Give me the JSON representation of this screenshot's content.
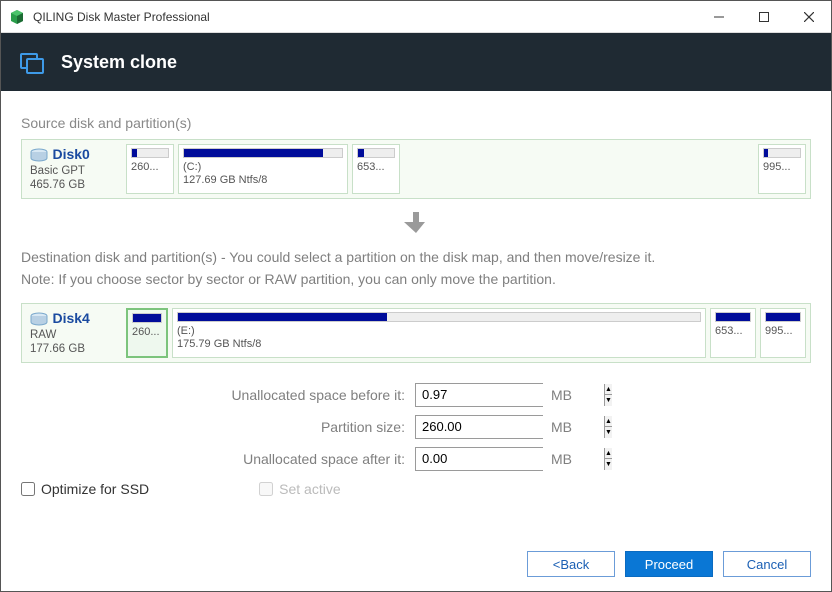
{
  "titlebar": {
    "title": "QILING Disk Master Professional"
  },
  "header": {
    "title": "System clone"
  },
  "source": {
    "label": "Source disk and partition(s)",
    "disk": {
      "name": "Disk0",
      "type": "Basic GPT",
      "size": "465.76 GB"
    },
    "parts": [
      {
        "label1": "",
        "label2": "260...",
        "fillPct": 14,
        "flex": 48
      },
      {
        "label1": "(C:)",
        "label2": "127.69 GB Ntfs/8",
        "fillPct": 88,
        "flex": 170
      },
      {
        "label1": "",
        "label2": "653...",
        "fillPct": 16,
        "flex": 48
      },
      {
        "label1": "",
        "label2": "995...",
        "fillPct": 12,
        "flex": 48,
        "rightAlign": true
      }
    ]
  },
  "dest": {
    "line1": "Destination disk and partition(s) - You could select a partition on the disk map, and then move/resize it.",
    "line2": "Note: If you choose sector by sector or RAW partition, you can only move the partition.",
    "disk": {
      "name": "Disk4",
      "type": "RAW",
      "size": "177.66 GB"
    },
    "parts": [
      {
        "label1": "",
        "label2": "260...",
        "fillPct": 100,
        "flex": 42,
        "selected": true
      },
      {
        "label1": "(E:)",
        "label2": "175.79 GB Ntfs/8",
        "fillPct": 40,
        "flex": 505
      },
      {
        "label1": "",
        "label2": "653...",
        "fillPct": 100,
        "flex": 46
      },
      {
        "label1": "",
        "label2": "995...",
        "fillPct": 100,
        "flex": 46
      }
    ]
  },
  "form": {
    "before_label": "Unallocated space before it:",
    "before_value": "0.97",
    "size_label": "Partition size:",
    "size_value": "260.00",
    "after_label": "Unallocated space after it:",
    "after_value": "0.00",
    "unit": "MB"
  },
  "options": {
    "ssd": "Optimize for SSD",
    "active": "Set active"
  },
  "footer": {
    "back": "<Back",
    "proceed": "Proceed",
    "cancel": "Cancel"
  }
}
